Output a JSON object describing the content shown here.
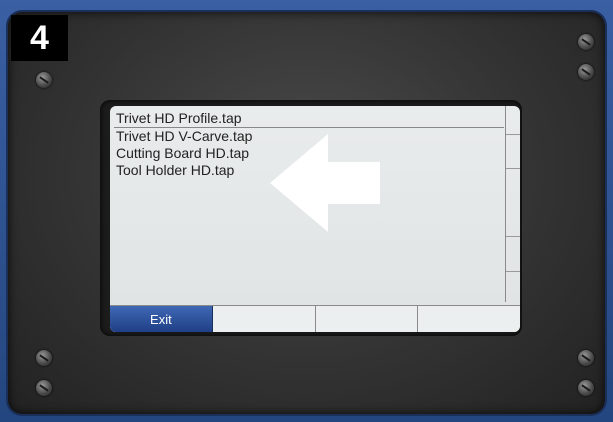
{
  "step": {
    "number": "4"
  },
  "screen": {
    "files": [
      "Trivet HD Profile.tap",
      "Trivet HD V-Carve.tap",
      "Cutting Board HD.tap",
      "Tool Holder HD.tap"
    ],
    "selected_index": 0,
    "softkeys": [
      "Exit",
      "",
      "",
      ""
    ]
  },
  "colors": {
    "background_blue": "#2a4a88",
    "softkey_active": "#2a4f9a",
    "arrow": "#ffffff"
  },
  "icons": {
    "pointer": "left-arrow-icon",
    "screws": "screw-icon"
  }
}
